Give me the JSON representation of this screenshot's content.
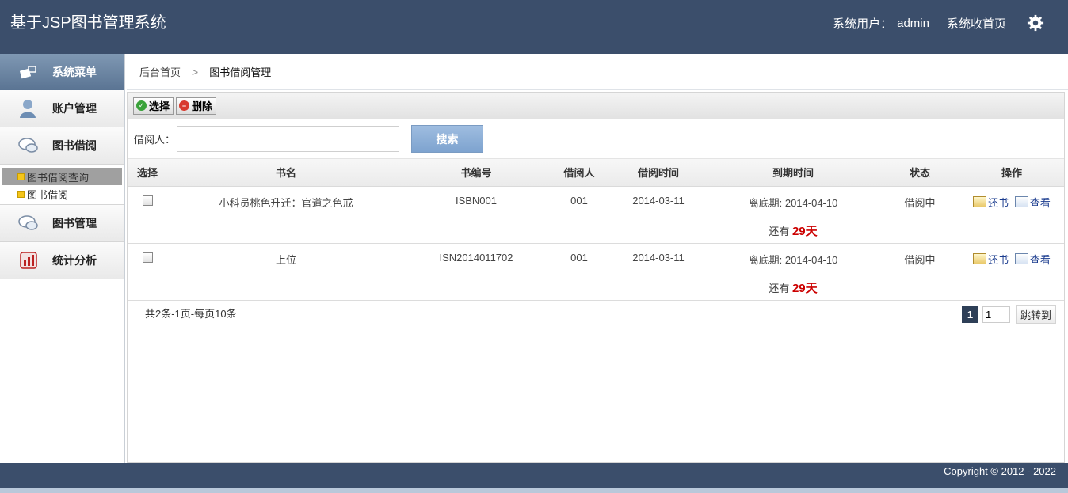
{
  "header": {
    "title": "基于JSP图书管理系统",
    "user_label": "系统用户：",
    "user_name": "admin",
    "home_link": "系统收首页",
    "settings_icon": "gear-icon"
  },
  "sidebar": {
    "menu_title": "系统菜单",
    "items": [
      {
        "label": "账户管理",
        "icon": "user-icon"
      },
      {
        "label": "图书借阅",
        "icon": "chat-icon"
      },
      {
        "label": "图书管理",
        "icon": "chat-icon"
      },
      {
        "label": "统计分析",
        "icon": "stats-icon"
      }
    ],
    "sub_items": [
      {
        "label": "图书借阅查询",
        "active": true
      },
      {
        "label": "图书借阅",
        "active": false
      }
    ]
  },
  "breadcrumb": {
    "home": "后台首页",
    "separator": ">",
    "current": "图书借阅管理"
  },
  "toolbar": {
    "select_label": "选择",
    "delete_label": "删除"
  },
  "search": {
    "label": "借阅人：",
    "value": "",
    "button": "搜索"
  },
  "table": {
    "headers": [
      "选择",
      "书名",
      "书编号",
      "借阅人",
      "借阅时间",
      "到期时间",
      "状态",
      "操作"
    ],
    "rows": [
      {
        "title": "小科员桃色升迁：官道之色戒",
        "book_no": "ISBN001",
        "borrower": "001",
        "borrow_date": "2014-03-11",
        "due_label": "离底期: 2014-04-10",
        "remain_prefix": "还有",
        "remain_days": "29天",
        "status": "借阅中",
        "return_label": "还书",
        "view_label": "查看"
      },
      {
        "title": "上位",
        "book_no": "ISN2014011702",
        "borrower": "001",
        "borrow_date": "2014-03-11",
        "due_label": "离底期: 2014-04-10",
        "remain_prefix": "还有",
        "remain_days": "29天",
        "status": "借阅中",
        "return_label": "还书",
        "view_label": "查看"
      }
    ]
  },
  "pager": {
    "info": "共2条-1页-每页10条",
    "current_page": "1",
    "jump_value": "1",
    "jump_label": "跳转到"
  },
  "footer": {
    "copyright": "Copyright © 2012 - 2022"
  }
}
